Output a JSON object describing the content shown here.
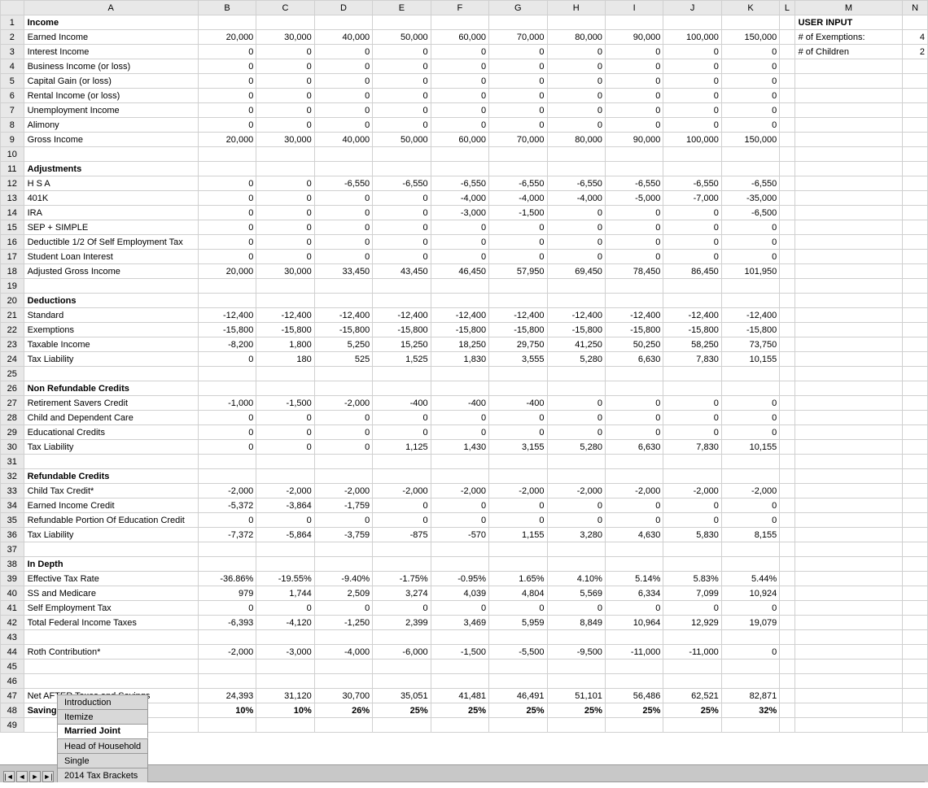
{
  "cols": {
    "header_row": [
      "",
      "A",
      "B",
      "C",
      "D",
      "E",
      "F",
      "G",
      "H",
      "I",
      "J",
      "K",
      "L",
      "M",
      "N"
    ],
    "col_b_label": "B",
    "col_c_label": "C"
  },
  "rows": [
    {
      "row": 1,
      "a": "Income",
      "bold": true,
      "m": "USER INPUT"
    },
    {
      "row": 2,
      "a": "Earned Income",
      "b": "20,000",
      "c": "30,000",
      "d": "40,000",
      "e": "50,000",
      "f": "60,000",
      "g": "70,000",
      "h": "80,000",
      "i": "90,000",
      "j": "100,000",
      "k": "150,000",
      "m": "# of Exemptions:",
      "n": "4"
    },
    {
      "row": 3,
      "a": "Interest Income",
      "b": "0",
      "c": "0",
      "d": "0",
      "e": "0",
      "f": "0",
      "g": "0",
      "h": "0",
      "i": "0",
      "j": "0",
      "k": "0",
      "m": "# of Children",
      "n": "2"
    },
    {
      "row": 4,
      "a": "Business Income (or loss)",
      "b": "0",
      "c": "0",
      "d": "0",
      "e": "0",
      "f": "0",
      "g": "0",
      "h": "0",
      "i": "0",
      "j": "0",
      "k": "0"
    },
    {
      "row": 5,
      "a": "Capital Gain (or loss)",
      "b": "0",
      "c": "0",
      "d": "0",
      "e": "0",
      "f": "0",
      "g": "0",
      "h": "0",
      "i": "0",
      "j": "0",
      "k": "0"
    },
    {
      "row": 6,
      "a": "Rental Income (or loss)",
      "b": "0",
      "c": "0",
      "d": "0",
      "e": "0",
      "f": "0",
      "g": "0",
      "h": "0",
      "i": "0",
      "j": "0",
      "k": "0"
    },
    {
      "row": 7,
      "a": "Unemployment Income",
      "b": "0",
      "c": "0",
      "d": "0",
      "e": "0",
      "f": "0",
      "g": "0",
      "h": "0",
      "i": "0",
      "j": "0",
      "k": "0"
    },
    {
      "row": 8,
      "a": "Alimony",
      "b": "0",
      "c": "0",
      "d": "0",
      "e": "0",
      "f": "0",
      "g": "0",
      "h": "0",
      "i": "0",
      "j": "0",
      "k": "0"
    },
    {
      "row": 9,
      "a": "Gross Income",
      "b": "20,000",
      "c": "30,000",
      "d": "40,000",
      "e": "50,000",
      "f": "60,000",
      "g": "70,000",
      "h": "80,000",
      "i": "90,000",
      "j": "100,000",
      "k": "150,000"
    },
    {
      "row": 10,
      "a": ""
    },
    {
      "row": 11,
      "a": "Adjustments",
      "bold": true
    },
    {
      "row": 12,
      "a": "H S A",
      "b": "0",
      "c": "0",
      "d": "-6,550",
      "e": "-6,550",
      "f": "-6,550",
      "g": "-6,550",
      "h": "-6,550",
      "i": "-6,550",
      "j": "-6,550",
      "k": "-6,550"
    },
    {
      "row": 13,
      "a": "401K",
      "b": "0",
      "c": "0",
      "d": "0",
      "e": "0",
      "f": "-4,000",
      "g": "-4,000",
      "h": "-4,000",
      "i": "-5,000",
      "j": "-7,000",
      "k": "-35,000"
    },
    {
      "row": 14,
      "a": "IRA",
      "b": "0",
      "c": "0",
      "d": "0",
      "e": "0",
      "f": "-3,000",
      "g": "-1,500",
      "h": "0",
      "i": "0",
      "j": "0",
      "k": "-6,500"
    },
    {
      "row": 15,
      "a": "SEP + SIMPLE",
      "b": "0",
      "c": "0",
      "d": "0",
      "e": "0",
      "f": "0",
      "g": "0",
      "h": "0",
      "i": "0",
      "j": "0",
      "k": "0"
    },
    {
      "row": 16,
      "a": "Deductible 1/2 Of Self Employment Tax",
      "b": "0",
      "c": "0",
      "d": "0",
      "e": "0",
      "f": "0",
      "g": "0",
      "h": "0",
      "i": "0",
      "j": "0",
      "k": "0"
    },
    {
      "row": 17,
      "a": "Student Loan Interest",
      "b": "0",
      "c": "0",
      "d": "0",
      "e": "0",
      "f": "0",
      "g": "0",
      "h": "0",
      "i": "0",
      "j": "0",
      "k": "0"
    },
    {
      "row": 18,
      "a": "Adjusted Gross Income",
      "b": "20,000",
      "c": "30,000",
      "d": "33,450",
      "e": "43,450",
      "f": "46,450",
      "g": "57,950",
      "h": "69,450",
      "i": "78,450",
      "j": "86,450",
      "k": "101,950"
    },
    {
      "row": 19,
      "a": ""
    },
    {
      "row": 20,
      "a": "Deductions",
      "bold": true
    },
    {
      "row": 21,
      "a": "Standard",
      "b": "-12,400",
      "c": "-12,400",
      "d": "-12,400",
      "e": "-12,400",
      "f": "-12,400",
      "g": "-12,400",
      "h": "-12,400",
      "i": "-12,400",
      "j": "-12,400",
      "k": "-12,400"
    },
    {
      "row": 22,
      "a": "Exemptions",
      "b": "-15,800",
      "c": "-15,800",
      "d": "-15,800",
      "e": "-15,800",
      "f": "-15,800",
      "g": "-15,800",
      "h": "-15,800",
      "i": "-15,800",
      "j": "-15,800",
      "k": "-15,800"
    },
    {
      "row": 23,
      "a": "Taxable Income",
      "b": "-8,200",
      "c": "1,800",
      "d": "5,250",
      "e": "15,250",
      "f": "18,250",
      "g": "29,750",
      "h": "41,250",
      "i": "50,250",
      "j": "58,250",
      "k": "73,750"
    },
    {
      "row": 24,
      "a": "Tax Liability",
      "b": "0",
      "c": "180",
      "d": "525",
      "e": "1,525",
      "f": "1,830",
      "g": "3,555",
      "h": "5,280",
      "i": "6,630",
      "j": "7,830",
      "k": "10,155"
    },
    {
      "row": 25,
      "a": ""
    },
    {
      "row": 26,
      "a": "Non Refundable Credits",
      "bold": true
    },
    {
      "row": 27,
      "a": "Retirement Savers Credit",
      "b": "-1,000",
      "c": "-1,500",
      "d": "-2,000",
      "e": "-400",
      "f": "-400",
      "g": "-400",
      "h": "0",
      "i": "0",
      "j": "0",
      "k": "0"
    },
    {
      "row": 28,
      "a": "Child and Dependent Care",
      "b": "0",
      "c": "0",
      "d": "0",
      "e": "0",
      "f": "0",
      "g": "0",
      "h": "0",
      "i": "0",
      "j": "0",
      "k": "0"
    },
    {
      "row": 29,
      "a": "Educational Credits",
      "b": "0",
      "c": "0",
      "d": "0",
      "e": "0",
      "f": "0",
      "g": "0",
      "h": "0",
      "i": "0",
      "j": "0",
      "k": "0"
    },
    {
      "row": 30,
      "a": "Tax Liability",
      "b": "0",
      "c": "0",
      "d": "0",
      "e": "1,125",
      "f": "1,430",
      "g": "3,155",
      "h": "5,280",
      "i": "6,630",
      "j": "7,830",
      "k": "10,155"
    },
    {
      "row": 31,
      "a": ""
    },
    {
      "row": 32,
      "a": "Refundable Credits",
      "bold": true
    },
    {
      "row": 33,
      "a": "Child Tax Credit*",
      "b": "-2,000",
      "c": "-2,000",
      "d": "-2,000",
      "e": "-2,000",
      "f": "-2,000",
      "g": "-2,000",
      "h": "-2,000",
      "i": "-2,000",
      "j": "-2,000",
      "k": "-2,000"
    },
    {
      "row": 34,
      "a": "Earned Income Credit",
      "b": "-5,372",
      "c": "-3,864",
      "d": "-1,759",
      "e": "0",
      "f": "0",
      "g": "0",
      "h": "0",
      "i": "0",
      "j": "0",
      "k": "0"
    },
    {
      "row": 35,
      "a": "Refundable Portion Of Education Credit",
      "b": "0",
      "c": "0",
      "d": "0",
      "e": "0",
      "f": "0",
      "g": "0",
      "h": "0",
      "i": "0",
      "j": "0",
      "k": "0"
    },
    {
      "row": 36,
      "a": "Tax Liability",
      "b": "-7,372",
      "c": "-5,864",
      "d": "-3,759",
      "e": "-875",
      "f": "-570",
      "g": "1,155",
      "h": "3,280",
      "i": "4,630",
      "j": "5,830",
      "k": "8,155"
    },
    {
      "row": 37,
      "a": ""
    },
    {
      "row": 38,
      "a": "In Depth",
      "bold": true
    },
    {
      "row": 39,
      "a": "Effective Tax Rate",
      "b": "-36.86%",
      "c": "-19.55%",
      "d": "-9.40%",
      "e": "-1.75%",
      "f": "-0.95%",
      "g": "1.65%",
      "h": "4.10%",
      "i": "5.14%",
      "j": "5.83%",
      "k": "5.44%"
    },
    {
      "row": 40,
      "a": "SS and Medicare",
      "b": "979",
      "c": "1,744",
      "d": "2,509",
      "e": "3,274",
      "f": "4,039",
      "g": "4,804",
      "h": "5,569",
      "i": "6,334",
      "j": "7,099",
      "k": "10,924"
    },
    {
      "row": 41,
      "a": "Self Employment Tax",
      "b": "0",
      "c": "0",
      "d": "0",
      "e": "0",
      "f": "0",
      "g": "0",
      "h": "0",
      "i": "0",
      "j": "0",
      "k": "0"
    },
    {
      "row": 42,
      "a": "Total Federal Income Taxes",
      "b": "-6,393",
      "c": "-4,120",
      "d": "-1,250",
      "e": "2,399",
      "f": "3,469",
      "g": "5,959",
      "h": "8,849",
      "i": "10,964",
      "j": "12,929",
      "k": "19,079"
    },
    {
      "row": 43,
      "a": ""
    },
    {
      "row": 44,
      "a": "Roth Contribution*",
      "b": "-2,000",
      "c": "-3,000",
      "d": "-4,000",
      "e": "-6,000",
      "f": "-1,500",
      "g": "-5,500",
      "h": "-9,500",
      "i": "-11,000",
      "j": "-11,000",
      "k": "0"
    },
    {
      "row": 45,
      "a": ""
    },
    {
      "row": 46,
      "a": ""
    },
    {
      "row": 47,
      "a": "Net AFTER Taxes and Savings",
      "b": "24,393",
      "c": "31,120",
      "d": "30,700",
      "e": "35,051",
      "f": "41,481",
      "g": "46,491",
      "h": "51,101",
      "i": "56,486",
      "j": "62,521",
      "k": "82,871"
    },
    {
      "row": 48,
      "a": "Savings Percent",
      "bold": true,
      "b": "10%",
      "c": "10%",
      "d": "26%",
      "e": "25%",
      "f": "25%",
      "g": "25%",
      "h": "25%",
      "i": "25%",
      "j": "25%",
      "k": "32%"
    },
    {
      "row": 49,
      "a": ""
    }
  ],
  "tabs": [
    {
      "label": "Introduction",
      "active": false
    },
    {
      "label": "Itemize",
      "active": false
    },
    {
      "label": "Married Joint",
      "active": true
    },
    {
      "label": "Head of Household",
      "active": false
    },
    {
      "label": "Single",
      "active": false
    },
    {
      "label": "2014 Tax Brackets",
      "active": false
    }
  ],
  "col_headers": [
    "",
    "A",
    "B",
    "C",
    "D",
    "E",
    "F",
    "G",
    "H",
    "I",
    "J",
    "K",
    "L",
    "M",
    "N"
  ]
}
